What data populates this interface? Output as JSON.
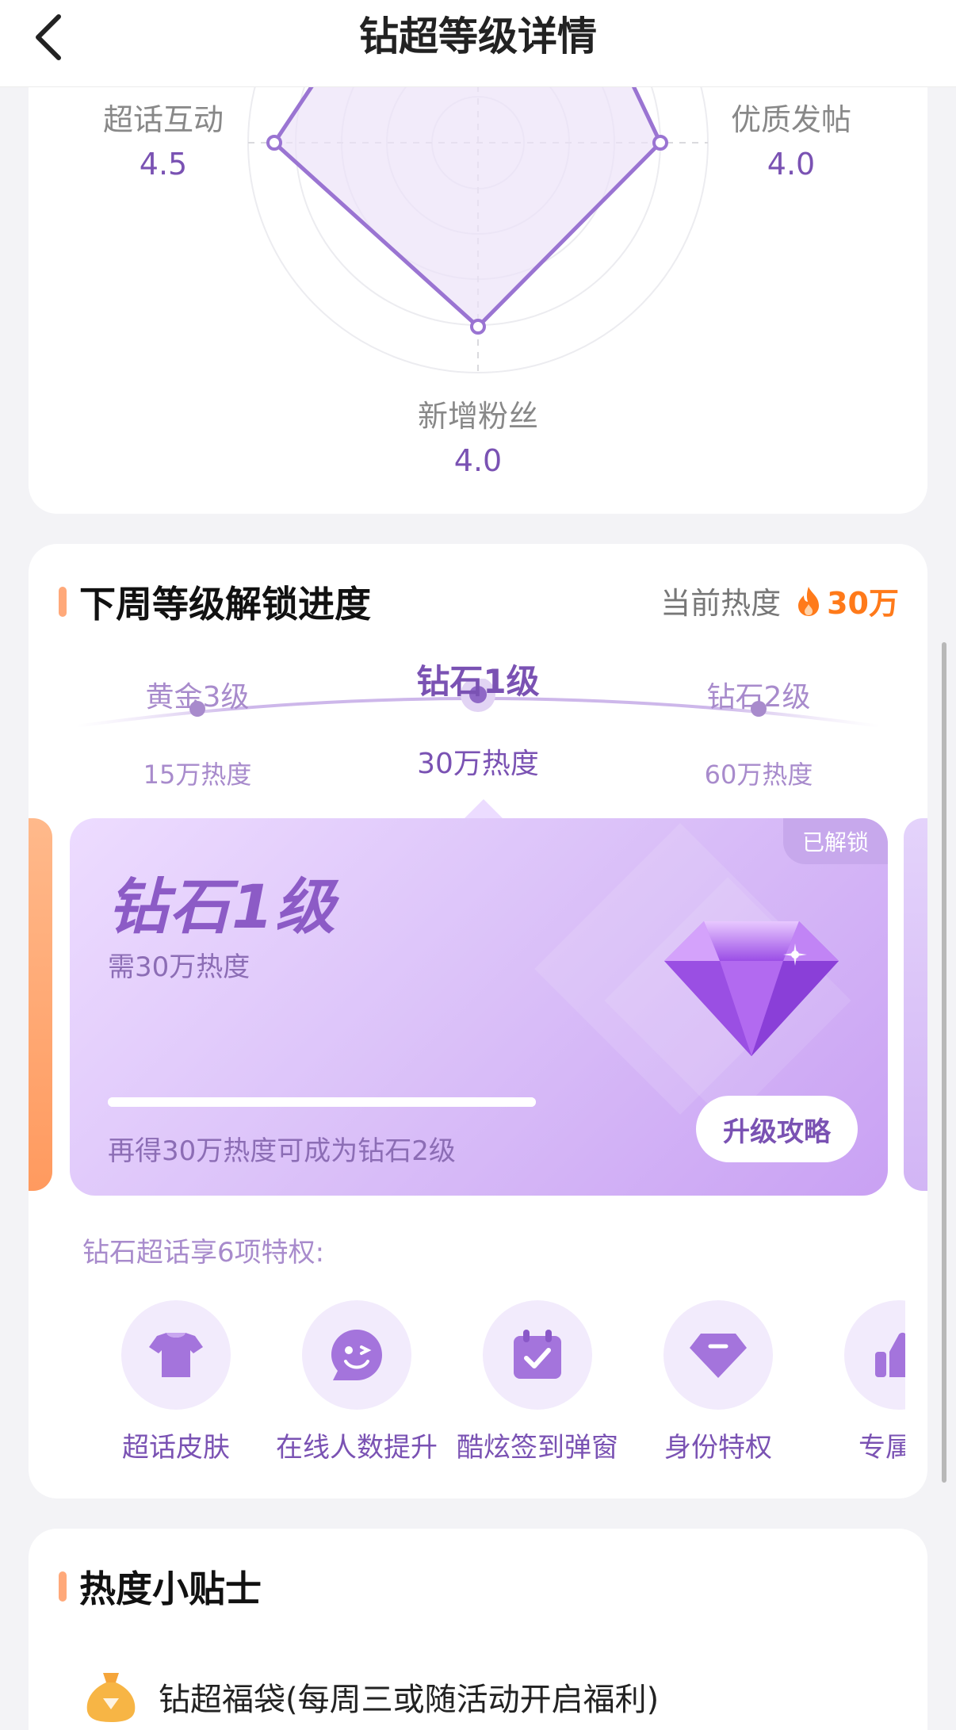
{
  "header": {
    "title": "钻超等级详情"
  },
  "radar": {
    "axes": [
      {
        "name": "超话互动",
        "value": "4.5"
      },
      {
        "name": "优质发帖",
        "value": "4.0"
      },
      {
        "name": "新增粉丝",
        "value": "4.0"
      }
    ]
  },
  "progress": {
    "title": "下周等级解锁进度",
    "current_heat_label": "当前热度",
    "current_heat_value": "30万",
    "levels": [
      {
        "name": "黄金3级",
        "heat": "15万热度"
      },
      {
        "name": "钻石1级",
        "heat": "30万热度"
      },
      {
        "name": "钻石2级",
        "heat": "60万热度"
      }
    ],
    "card": {
      "badge": "已解锁",
      "title": "钻石1级",
      "requirement": "需30万热度",
      "progress_fraction": 1.0,
      "tip": "再得30万热度可成为钻石2级",
      "button": "升级攻略"
    },
    "privileges_title": "钻石超话享6项特权:",
    "privileges": [
      {
        "label": "超话皮肤",
        "icon": "tshirt-icon"
      },
      {
        "label": "在线人数提升",
        "icon": "smile-chat-icon"
      },
      {
        "label": "酷炫签到弹窗",
        "icon": "calendar-check-icon"
      },
      {
        "label": "身份特权",
        "icon": "gem-icon"
      },
      {
        "label": "专属推",
        "icon": "thumbs-up-icon"
      }
    ]
  },
  "tips": {
    "title": "热度小贴士",
    "items": [
      {
        "text": "钻超福袋(每周三或随活动开启福利)",
        "icon": "lucky-bag-icon"
      }
    ]
  },
  "colors": {
    "accent": "#7a52b3",
    "heat": "#ff7a1a",
    "section_bar": "#ffa97a"
  }
}
